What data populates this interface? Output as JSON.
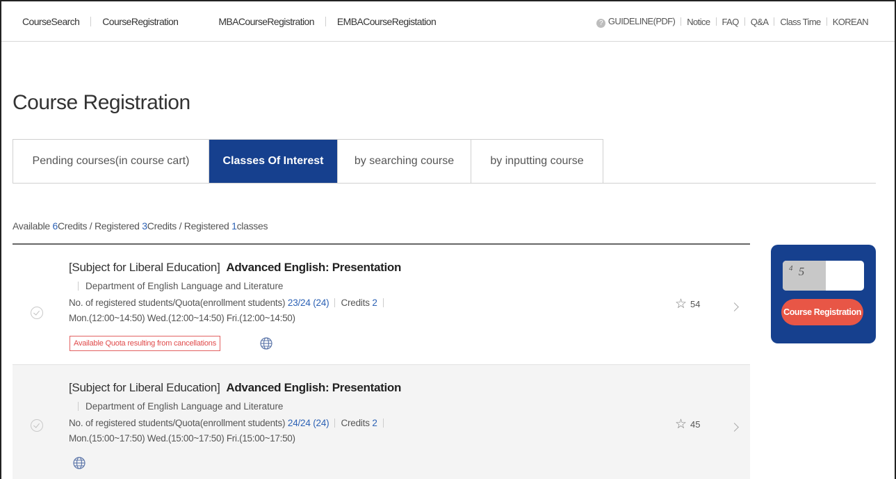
{
  "nav": {
    "links": [
      "CourseSearch",
      "CourseRegistration",
      "MBACourseRegistration",
      "EMBACourseRegistation"
    ],
    "utility": [
      "GUIDELINE(PDF)",
      "Notice",
      "FAQ",
      "Q&A",
      "Class Time",
      "KOREAN"
    ],
    "help_icon": "?"
  },
  "page": {
    "title": "Course Registration"
  },
  "tabs": [
    {
      "label": "Pending courses(in course cart)",
      "active": false
    },
    {
      "label": "Classes Of Interest",
      "active": true
    },
    {
      "label": "by searching course",
      "active": false
    },
    {
      "label": "by inputting course",
      "active": false
    }
  ],
  "summary": {
    "available_label": "Available ",
    "available_num": "6",
    "credits_label": "Credits / Registered ",
    "registered_credits": "3",
    "credits_label2": "Credits / Registered ",
    "registered_classes": "1",
    "classes_label": "classes"
  },
  "courses": [
    {
      "category": "[Subject for Liberal Education]",
      "name": "Advanced English: Presentation",
      "department": "Department of English Language and Literature",
      "enroll_label": "No. of registered students/Quota(enrollment students)",
      "enroll_value": "23/24 (24)",
      "credits_label": "Credits",
      "credits_value": "2",
      "schedule": "Mon.(12:00~14:50) Wed.(12:00~14:50) Fri.(12:00~14:50)",
      "tag": "Available Quota resulting from cancellations",
      "stars": "54"
    },
    {
      "category": "[Subject for Liberal Education]",
      "name": "Advanced English: Presentation",
      "department": "Department of English Language and Literature",
      "enroll_label": "No. of registered students/Quota(enrollment students)",
      "enroll_value": "24/24 (24)",
      "credits_label": "Credits",
      "credits_value": "2",
      "schedule": "Mon.(15:00~17:50) Wed.(15:00~17:50) Fri.(15:00~17:50)",
      "stars": "45"
    }
  ],
  "side_panel": {
    "captcha_sup": "4",
    "captcha_text": "5",
    "button_label": "Course Registration",
    "colors": {
      "panel": "#16408e",
      "button": "#e85646"
    }
  },
  "colors": {
    "accent": "#16408e",
    "link_blue": "#2d62b5",
    "tag_red": "#e04a4a"
  }
}
